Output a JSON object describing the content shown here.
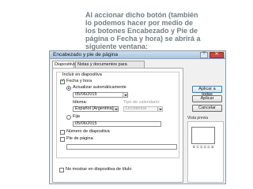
{
  "caption": [
    "Al accionar dicho botón (también",
    "lo podemos hacer por medio de",
    "los botones Encabezado y Pie de",
    "página o Fecha y hora) se abrirá a",
    "siguiente ventana:"
  ],
  "window": {
    "title": "Encabezado y pie de página",
    "help_glyph": "?",
    "close_glyph": "✕"
  },
  "tabs": [
    "Diapositiva",
    "Notas y documentos para distribuir"
  ],
  "group": {
    "label": "Incluir en diapositiva",
    "fecha_hora": "Fecha y hora",
    "actualizar": "Actualizar automáticamente",
    "date_value": "05/06/2015",
    "idioma_label": "Idioma:",
    "idioma_value": "Español (Argentina)",
    "calendario_label": "Tipo de calendario:",
    "calendario_value": "Occidental",
    "fija": "Fija",
    "fija_value": "05/06/2015",
    "numero": "Número de diapositiva",
    "pie": "Pie de página"
  },
  "no_mostrar": "No mostrar en diapositiva de título",
  "buttons": {
    "apply_all": "Aplicar a todas",
    "apply": "Aplicar",
    "cancel": "Cancelar"
  },
  "preview_label": "Vista previa",
  "state": {
    "fecha_hora_checked": true,
    "actualizar_selected": true,
    "fija_selected": false,
    "numero_checked": false,
    "pie_checked": false,
    "no_mostrar_checked": false
  }
}
